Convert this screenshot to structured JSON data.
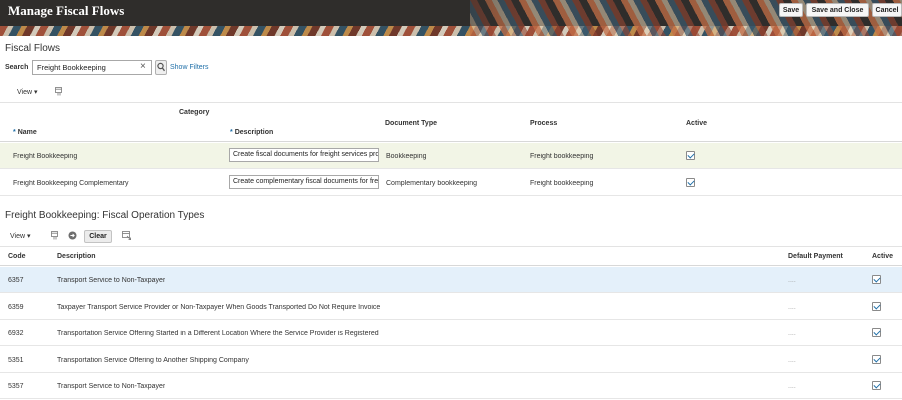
{
  "header": {
    "title": "Manage Fiscal Flows",
    "buttons": {
      "save": "Save",
      "save_close": "Save and Close",
      "cancel": "Cancel"
    }
  },
  "fiscal_flows": {
    "section_title": "Fiscal Flows",
    "search_label": "Search",
    "search_value": "Freight Bookkeeping",
    "show_filters": "Show Filters",
    "view_label": "View ▾",
    "group_header": "Category",
    "columns": {
      "name": "Name",
      "description": "Description",
      "document_type": "Document Type",
      "process": "Process",
      "active": "Active"
    },
    "required_marker": "*",
    "rows": [
      {
        "name": "Freight Bookkeeping",
        "description": "Create fiscal documents for freight services provided",
        "document_type": "Bookkeeping",
        "process": "Freight bookkeeping",
        "active": true
      },
      {
        "name": "Freight Bookkeeping Complementary",
        "description": "Create complementary fiscal documents for freight services",
        "document_type": "Complementary bookkeeping",
        "process": "Freight bookkeeping",
        "active": true
      }
    ]
  },
  "operation_types": {
    "section_title": "Freight Bookkeeping: Fiscal Operation Types",
    "view_label": "View ▾",
    "clear_label": "Clear",
    "columns": {
      "code": "Code",
      "description": "Description",
      "default_payment": "Default Payment",
      "active": "Active"
    },
    "empty_value": "....",
    "rows": [
      {
        "code": "6357",
        "description": "Transport Service to Non-Taxpayer",
        "active": true
      },
      {
        "code": "6359",
        "description": "Taxpayer Transport Service Provider or Non-Taxpayer When Goods Transported Do Not Require Invoice",
        "active": true
      },
      {
        "code": "6932",
        "description": "Transportation Service Offering Started in a Different Location Where the Service Provider is Registered",
        "active": true
      },
      {
        "code": "5351",
        "description": "Transportation Service Offering to Another Shipping Company",
        "active": true
      },
      {
        "code": "5357",
        "description": "Transport Service to Non-Taxpayer",
        "active": true
      }
    ]
  },
  "icons": [
    "search-icon",
    "clear-x-icon",
    "detach-icon",
    "go-arrow-icon",
    "export-icon"
  ],
  "colors": {
    "header_bg": "#2f2d2b",
    "link": "#1f6fa8",
    "selected_row": "#e4f0fa",
    "edited_row": "#f2f5e6"
  }
}
